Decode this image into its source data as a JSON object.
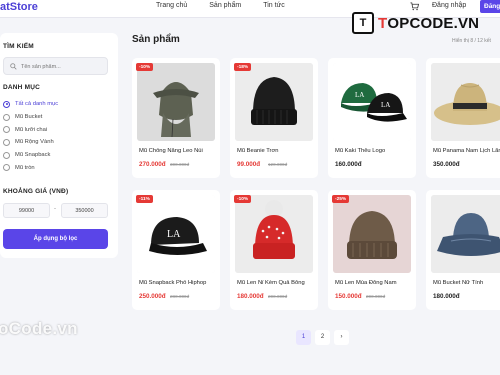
{
  "header": {
    "brand": "atStore",
    "nav": [
      "Trang chủ",
      "Sản phẩm",
      "Tin tức"
    ],
    "login": "Đăng nhập",
    "register": "Đăng k",
    "cart_icon": "cart-icon"
  },
  "watermark": {
    "logo_mark": "T",
    "logo_text": "TOPCODE.VN",
    "bottom_text": "oCode.vn"
  },
  "sidebar": {
    "search_title": "TÌM KIẾM",
    "search_placeholder": "Tên sản phẩm...",
    "category_title": "DANH MỤC",
    "categories": [
      "Tất cả danh mục",
      "Mũ Bucket",
      "Mũ lưỡi chai",
      "Mũ Rộng Vành",
      "Mũ Snapback",
      "Mũ tròn"
    ],
    "selected_category": 0,
    "price_title": "KHOẢNG GIÁ (VNĐ)",
    "price_min": "99000",
    "price_max": "350000",
    "price_separator": "-",
    "apply_label": "Áp dụng bộ lọc"
  },
  "main": {
    "title": "Sản phẩm",
    "showing": "Hiển thị 8 / 12 kết",
    "products": [
      {
        "name": "Mũ Chống Nắng Leo Núi",
        "price": "270.000đ",
        "old_price": "300.000đ",
        "badge": "-10%",
        "kind": "outdoor"
      },
      {
        "name": "Mũ Beanie Trơn",
        "price": "99.000đ",
        "old_price": "120.000đ",
        "badge": "-18%",
        "kind": "beanie_black"
      },
      {
        "name": "Mũ Kaki Thêu Logo",
        "price": "160.000đ",
        "old_price": "",
        "badge": "",
        "kind": "caps_green"
      },
      {
        "name": "Mũ Panama Nam Lịch Lãm",
        "price": "350.000đ",
        "old_price": "",
        "badge": "",
        "kind": "panama"
      },
      {
        "name": "Mũ Snapback Phố Hiphop",
        "price": "250.000đ",
        "old_price": "280.000đ",
        "badge": "-11%",
        "kind": "snapback"
      },
      {
        "name": "Mũ Len Nỉ Kèm Quả Bông",
        "price": "180.000đ",
        "old_price": "200.000đ",
        "badge": "-10%",
        "kind": "beanie_red"
      },
      {
        "name": "Mũ Len Mùa Đông Nam",
        "price": "150.000đ",
        "old_price": "200.000đ",
        "badge": "-25%",
        "kind": "beanie_brown"
      },
      {
        "name": "Mũ Bucket Nữ Tính",
        "price": "180.000đ",
        "old_price": "",
        "badge": "",
        "kind": "bucket"
      }
    ],
    "pages": [
      "1",
      "2",
      "›"
    ],
    "current_page": 0
  },
  "colors": {
    "accent": "#5a45e8",
    "sale": "#e53935",
    "background": "#f4f5f9"
  }
}
